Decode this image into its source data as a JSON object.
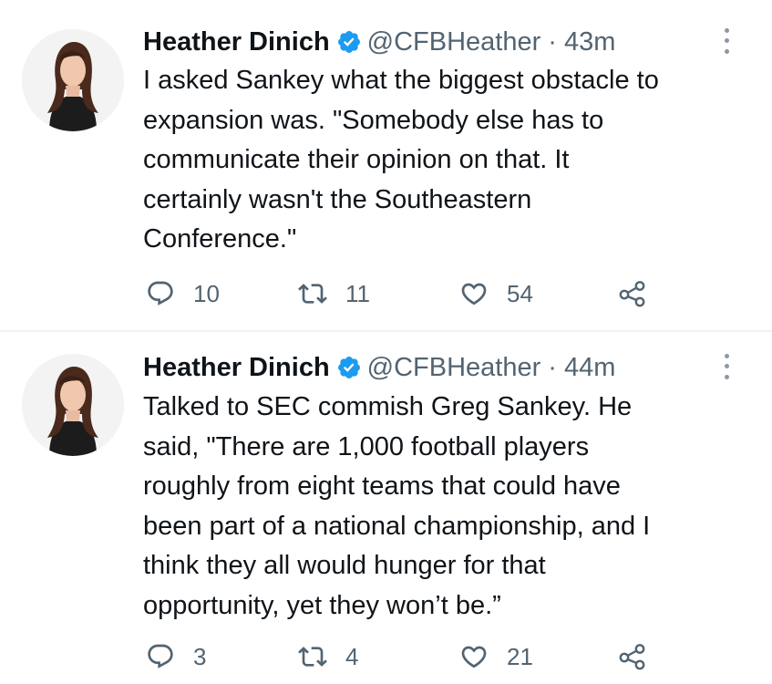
{
  "tweets": [
    {
      "display_name": "Heather Dinich",
      "handle": "@CFBHeather",
      "separator": "·",
      "time": "43m",
      "text": "I asked Sankey what the biggest obstacle to\nexpansion was. \"Somebody else has to\ncommunicate their opinion on that. It\ncertainly wasn't the Southeastern\nConference.\"",
      "replies": "10",
      "retweets": "11",
      "likes": "54"
    },
    {
      "display_name": "Heather Dinich",
      "handle": "@CFBHeather",
      "separator": "·",
      "time": "44m",
      "text": "Talked to SEC commish Greg Sankey. He\nsaid, \"There are 1,000 football players\nroughly from eight teams that could have\nbeen part of a national championship, and I\nthink they all would hunger for that\nopportunity, yet they won’t be.”",
      "replies": "3",
      "retweets": "4",
      "likes": "21"
    }
  ],
  "icons": {
    "verified": "verified-badge-icon",
    "more": "more-options-icon",
    "reply": "reply-icon",
    "retweet": "retweet-icon",
    "like": "heart-icon",
    "share": "share-icon"
  },
  "colors": {
    "text": "#0f1419",
    "secondary": "#536471",
    "verified": "#1d9bf0",
    "divider": "#eff3f4"
  }
}
